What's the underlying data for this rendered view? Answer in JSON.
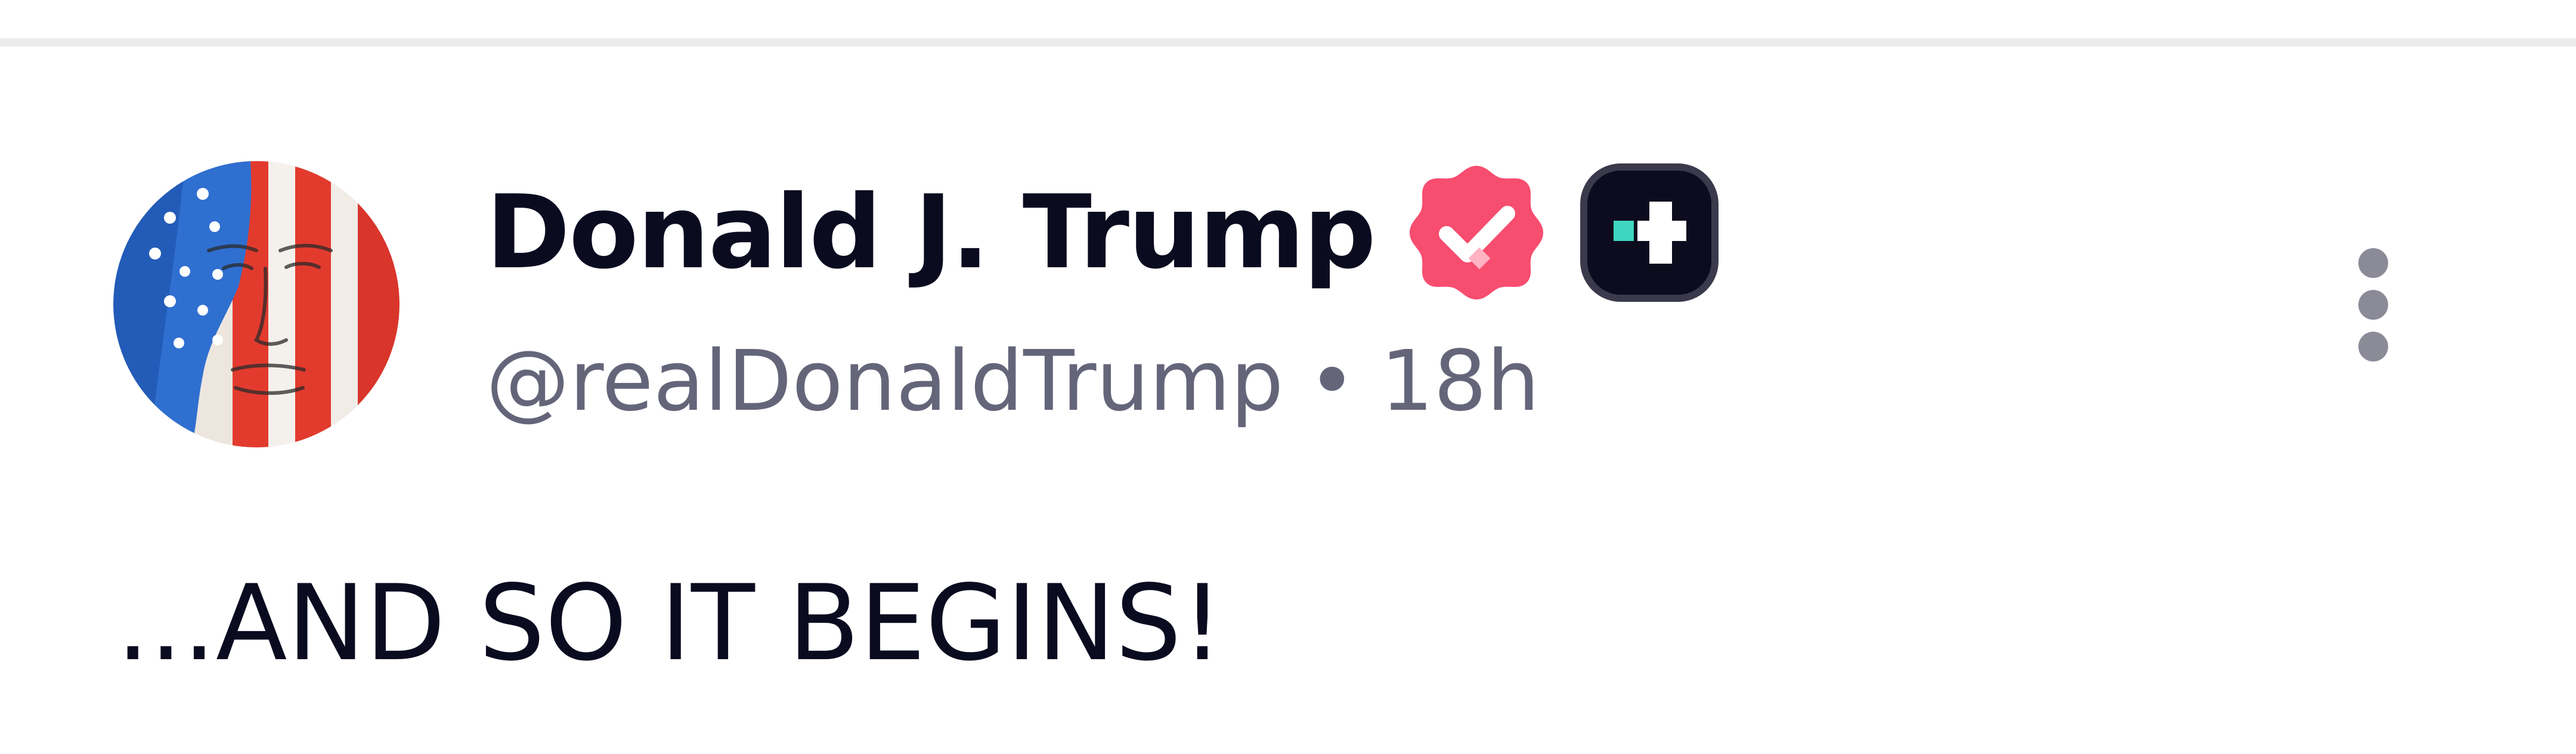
{
  "post": {
    "author": {
      "display_name": "Donald J. Trump",
      "handle": "@realDonaldTrump",
      "avatar": "avatar-image"
    },
    "separator": "•",
    "timestamp": "18h",
    "text": "...AND SO IT BEGINS!",
    "badges": {
      "verified": {
        "icon": "verified-check-icon",
        "color": "#f74d6f"
      },
      "plus": {
        "icon": "plus-icon",
        "color": "#0c0c1e",
        "accent": "#3ed6bf"
      }
    },
    "menu": {
      "icon": "more-vertical-icon"
    }
  },
  "colors": {
    "name": "#0b0b20",
    "meta": "#65657a",
    "divider": "#ececee",
    "more_dots": "#8b8b98"
  }
}
